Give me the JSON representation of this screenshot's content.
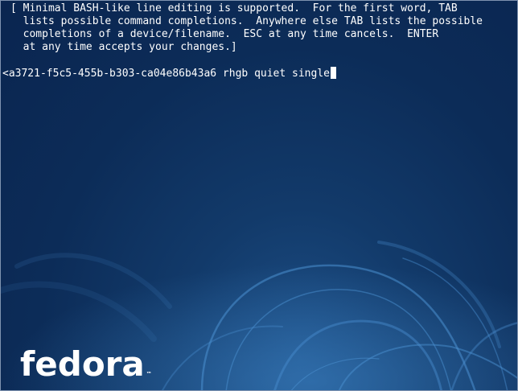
{
  "terminal": {
    "help_lines": [
      "[ Minimal BASH-like line editing is supported.  For the first word, TAB",
      "  lists possible command completions.  Anywhere else TAB lists the possible",
      "  completions of a device/filename.  ESC at any time cancels.  ENTER",
      "  at any time accepts your changes.]"
    ],
    "command_line": "<a3721-f5c5-455b-b303-ca04e86b43a6 rhgb quiet single"
  },
  "branding": {
    "logo_text": "fedora",
    "trademark": "™"
  },
  "colors": {
    "background": "#0b2a55",
    "text": "#ffffff",
    "border": "#7f93b0"
  }
}
